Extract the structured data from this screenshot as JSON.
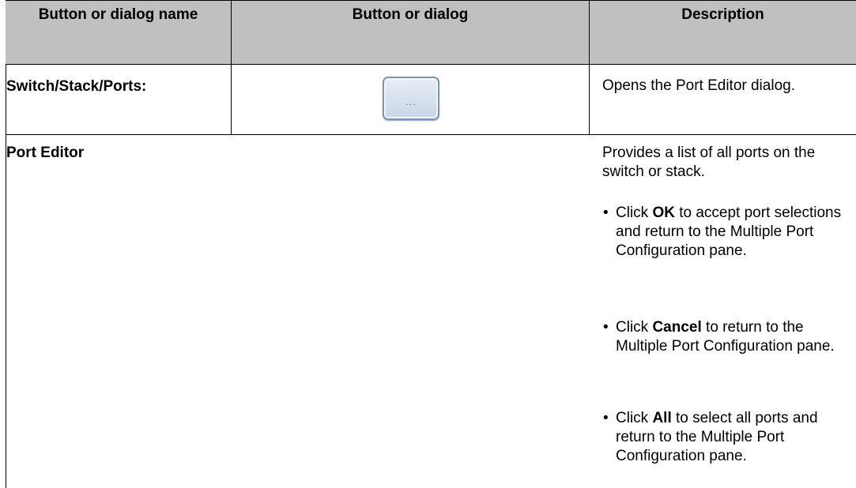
{
  "table": {
    "headers": [
      "Button or dialog name",
      "Button or dialog",
      "Description"
    ],
    "row1": {
      "name": "Switch/Stack/Ports:",
      "button_glyph": "...",
      "description": "Opens the Port Editor dialog."
    },
    "row2": {
      "name": "Port Editor",
      "description": "Provides a list of all ports on the switch or stack.",
      "bullets": [
        {
          "pre": "Click ",
          "bold": "OK",
          "post": " to accept port selections and return to the Multiple Port Configuration pane."
        },
        {
          "pre": "Click ",
          "bold": "Cancel",
          "post": " to return to the Multiple Port Configuration pane."
        },
        {
          "pre": "Click ",
          "bold": "All",
          "post": " to select all ports and return to the Multiple Port Configuration pane."
        }
      ]
    }
  },
  "colors": {
    "header_bg": "#c0c0c0",
    "border": "#000000",
    "button_border": "#7b95b8"
  }
}
